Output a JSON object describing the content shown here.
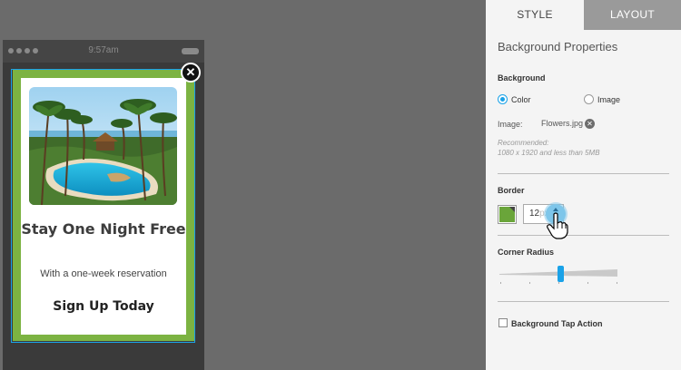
{
  "phone": {
    "time": "9:57am",
    "popup": {
      "title": "Stay One Night Free",
      "subtitle": "With a one-week reservation",
      "cta": "Sign Up Today",
      "close_icon": "close-icon",
      "border_color": "#7cb342"
    }
  },
  "panel": {
    "tabs": {
      "style": "STYLE",
      "layout": "LAYOUT"
    },
    "title": "Background Properties",
    "background": {
      "label": "Background",
      "options": {
        "color": "Color",
        "image": "Image"
      },
      "selected": "Color",
      "image_label": "Image:",
      "image_file": "Flowers.jpg",
      "recommended_1": "Recommended:",
      "recommended_2": "1080 x 1920 and less than 5MB"
    },
    "border": {
      "label": "Border",
      "color": "#6aa53a",
      "width_value": "12",
      "unit": "px"
    },
    "corner_radius": {
      "label": "Corner Radius",
      "value_fraction": 0.5
    },
    "tap_action": {
      "label": "Background Tap Action",
      "checked": false
    }
  },
  "colors": {
    "accent": "#1aa2e8",
    "canvas": "#6b6b6b",
    "panel": "#f4f4f4"
  }
}
